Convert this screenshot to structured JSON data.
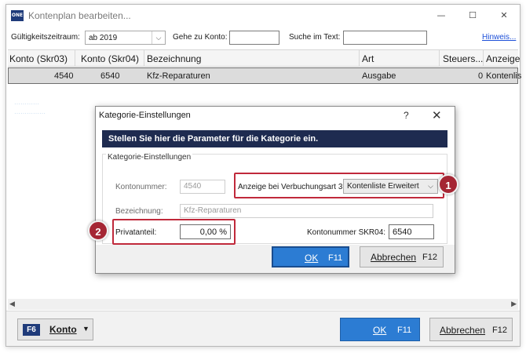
{
  "window": {
    "title": "Kontenplan bearbeiten...",
    "app_icon_text": "ONE",
    "minimize": "—",
    "maximize": "☐",
    "close": "✕"
  },
  "toolbar": {
    "period_label": "Gültigkeitszeitraum:",
    "period_value": "ab 2019",
    "goto_label": "Gehe zu Konto:",
    "goto_value": "",
    "search_label": "Suche im Text:",
    "search_value": "",
    "hint_link": "Hinweis..."
  },
  "grid": {
    "columns": [
      "Konto (Skr03)",
      "Konto (Skr04)",
      "Bezeichnung",
      "Art",
      "Steuers...",
      "Anzeige"
    ],
    "rows": [
      {
        "skr03": "4540",
        "skr04": "6540",
        "bezeichnung": "Kfz-Reparaturen",
        "art": "Ausgabe",
        "steuer": "0",
        "anzeige": "Kontenlis"
      }
    ]
  },
  "footer": {
    "konto_key": "F6",
    "konto_label": "Konto",
    "ok_label": "OK",
    "ok_key": "F11",
    "cancel_label": "Abbrechen",
    "cancel_key": "F12"
  },
  "dialog": {
    "title": "Kategorie-Einstellungen",
    "help": "?",
    "close": "✕",
    "banner": "Stellen Sie hier die Parameter für die Kategorie ein.",
    "group_title": "Kategorie-Einstellungen",
    "kontonummer_label": "Kontonummer:",
    "kontonummer_value": "4540",
    "anzeige_label": "Anzeige bei Verbuchungsart 3:",
    "anzeige_value": "Kontenliste Erweitert",
    "bezeichnung_label": "Bezeichnung:",
    "bezeichnung_value": "Kfz-Reparaturen",
    "privatanteil_label": "Privatanteil:",
    "privatanteil_value": "0,00 %",
    "skr04_label": "Kontonummer SKR04:",
    "skr04_value": "6540",
    "ok_label": "OK",
    "ok_key": "F11",
    "cancel_label": "Abbrechen",
    "cancel_key": "F12"
  },
  "callouts": [
    "1",
    "2"
  ],
  "colors": {
    "accent_blue": "#2c7cd3",
    "banner_navy": "#1e2b50",
    "callout_red": "#a52634"
  }
}
